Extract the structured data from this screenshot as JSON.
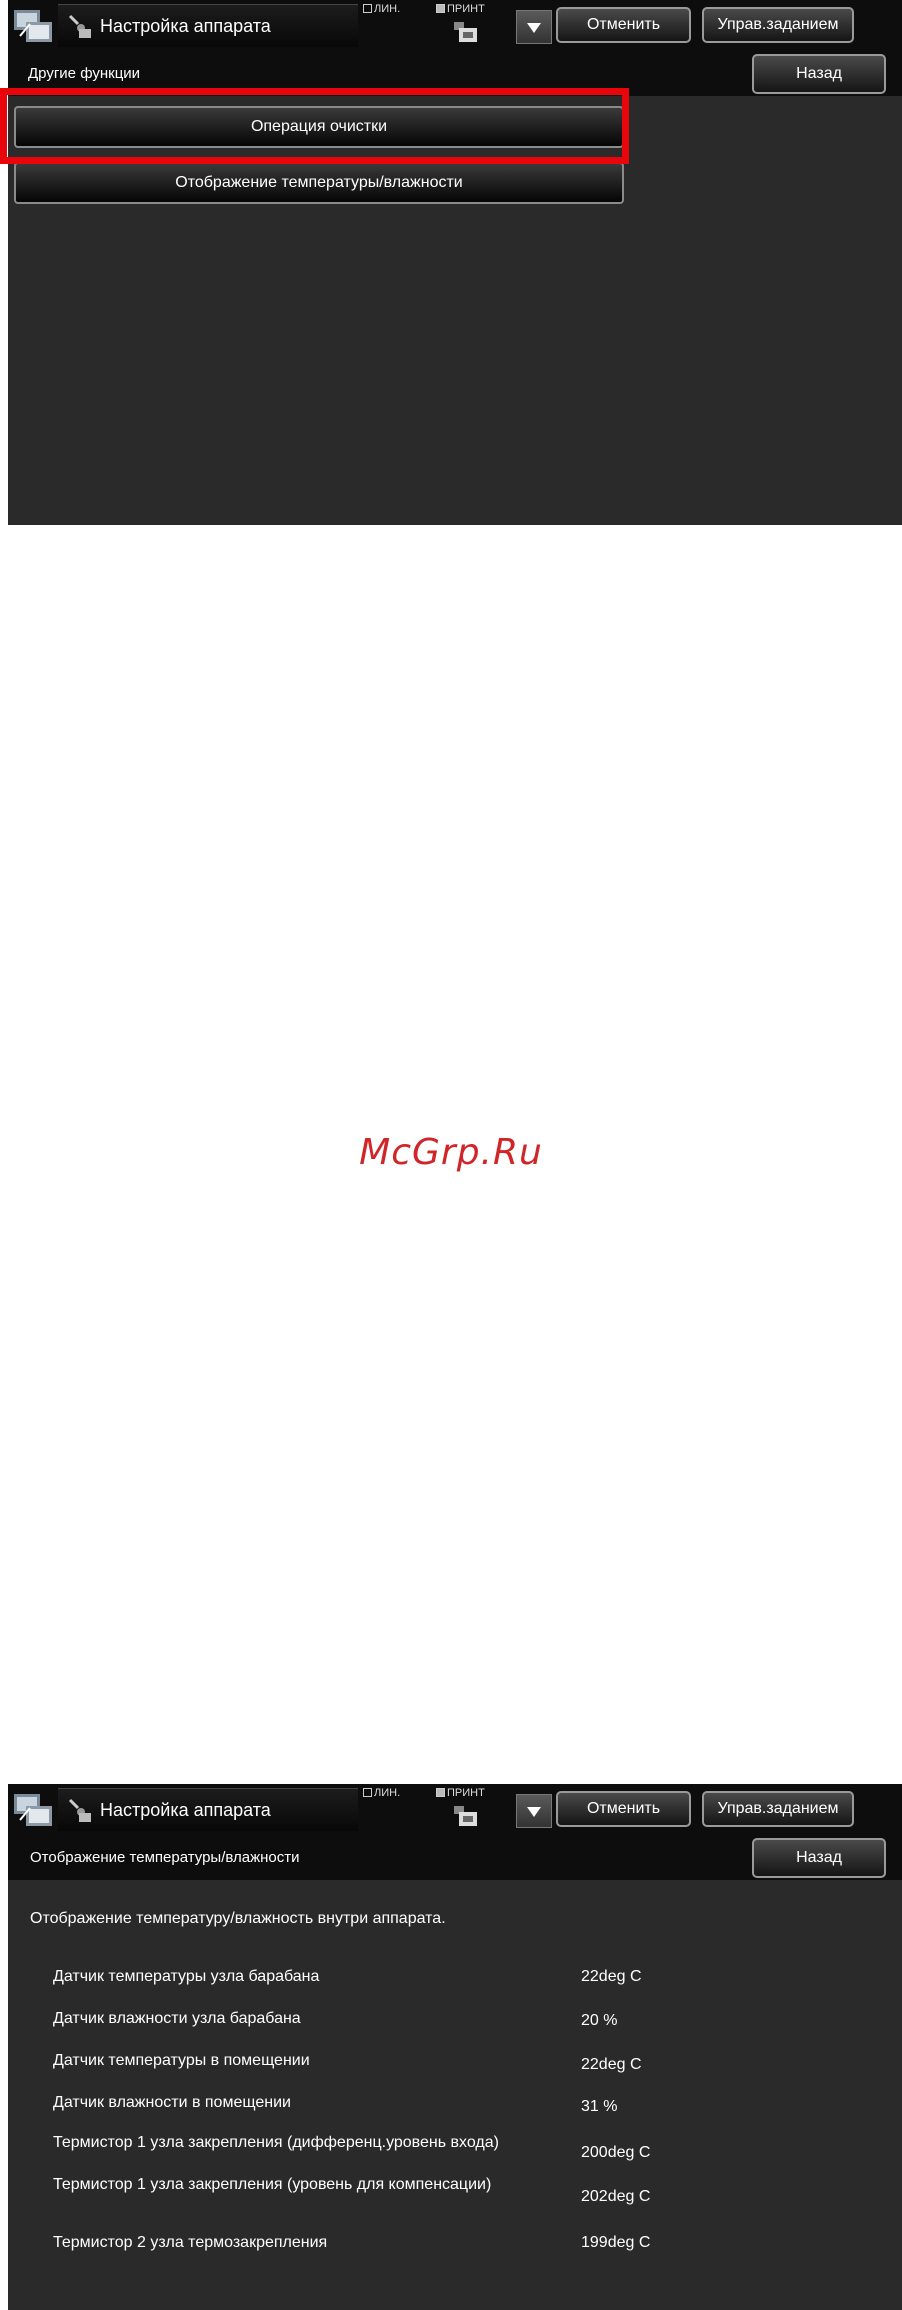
{
  "screen1": {
    "header": {
      "title": "Настройка аппарата",
      "status_lin": "ЛИН.",
      "status_print": "ПРИНТ",
      "cancel_label": "Отменить",
      "job_label": "Управ.заданием"
    },
    "subheader": {
      "title": "Другие функции",
      "back_label": "Назад"
    },
    "menu_items": [
      {
        "label": "Операция очистки"
      },
      {
        "label": "Отображение температуры/влажности"
      }
    ]
  },
  "watermark": "McGrp.Ru",
  "screen2": {
    "header": {
      "title": "Настройка аппарата",
      "status_lin": "ЛИН.",
      "status_print": "ПРИНТ",
      "cancel_label": "Отменить",
      "job_label": "Управ.заданием"
    },
    "subheader": {
      "title": "Отображение температуры/влажности",
      "back_label": "Назад"
    },
    "description": "Отображение температуру/влажность внутри аппарата.",
    "rows": [
      {
        "label": "Датчик температуры узла барабана",
        "value": "22deg C"
      },
      {
        "label": "Датчик влажности узла барабана",
        "value": "20 %"
      },
      {
        "label": "Датчик температуры в помещении",
        "value": "22deg C"
      },
      {
        "label": "Датчик влажности в помещении",
        "value": "31 %"
      },
      {
        "label": "Термистор 1 узла закрепления (дифференц.уровень входа)",
        "value": "200deg C"
      },
      {
        "label": "Термистор 1 узла закрепления (уровень для компенсации)",
        "value": "202deg C"
      },
      {
        "label": "Термистор 2 узла термозакрепления",
        "value": "199deg C"
      }
    ]
  },
  "colors": {
    "highlight": "#e8050c",
    "watermark": "#d0262a",
    "panel_bg": "#2a2a2a"
  },
  "icons": [
    "system-settings-icon",
    "wrench-tool-icon",
    "printer-status-icon",
    "dropdown-arrow-icon"
  ]
}
